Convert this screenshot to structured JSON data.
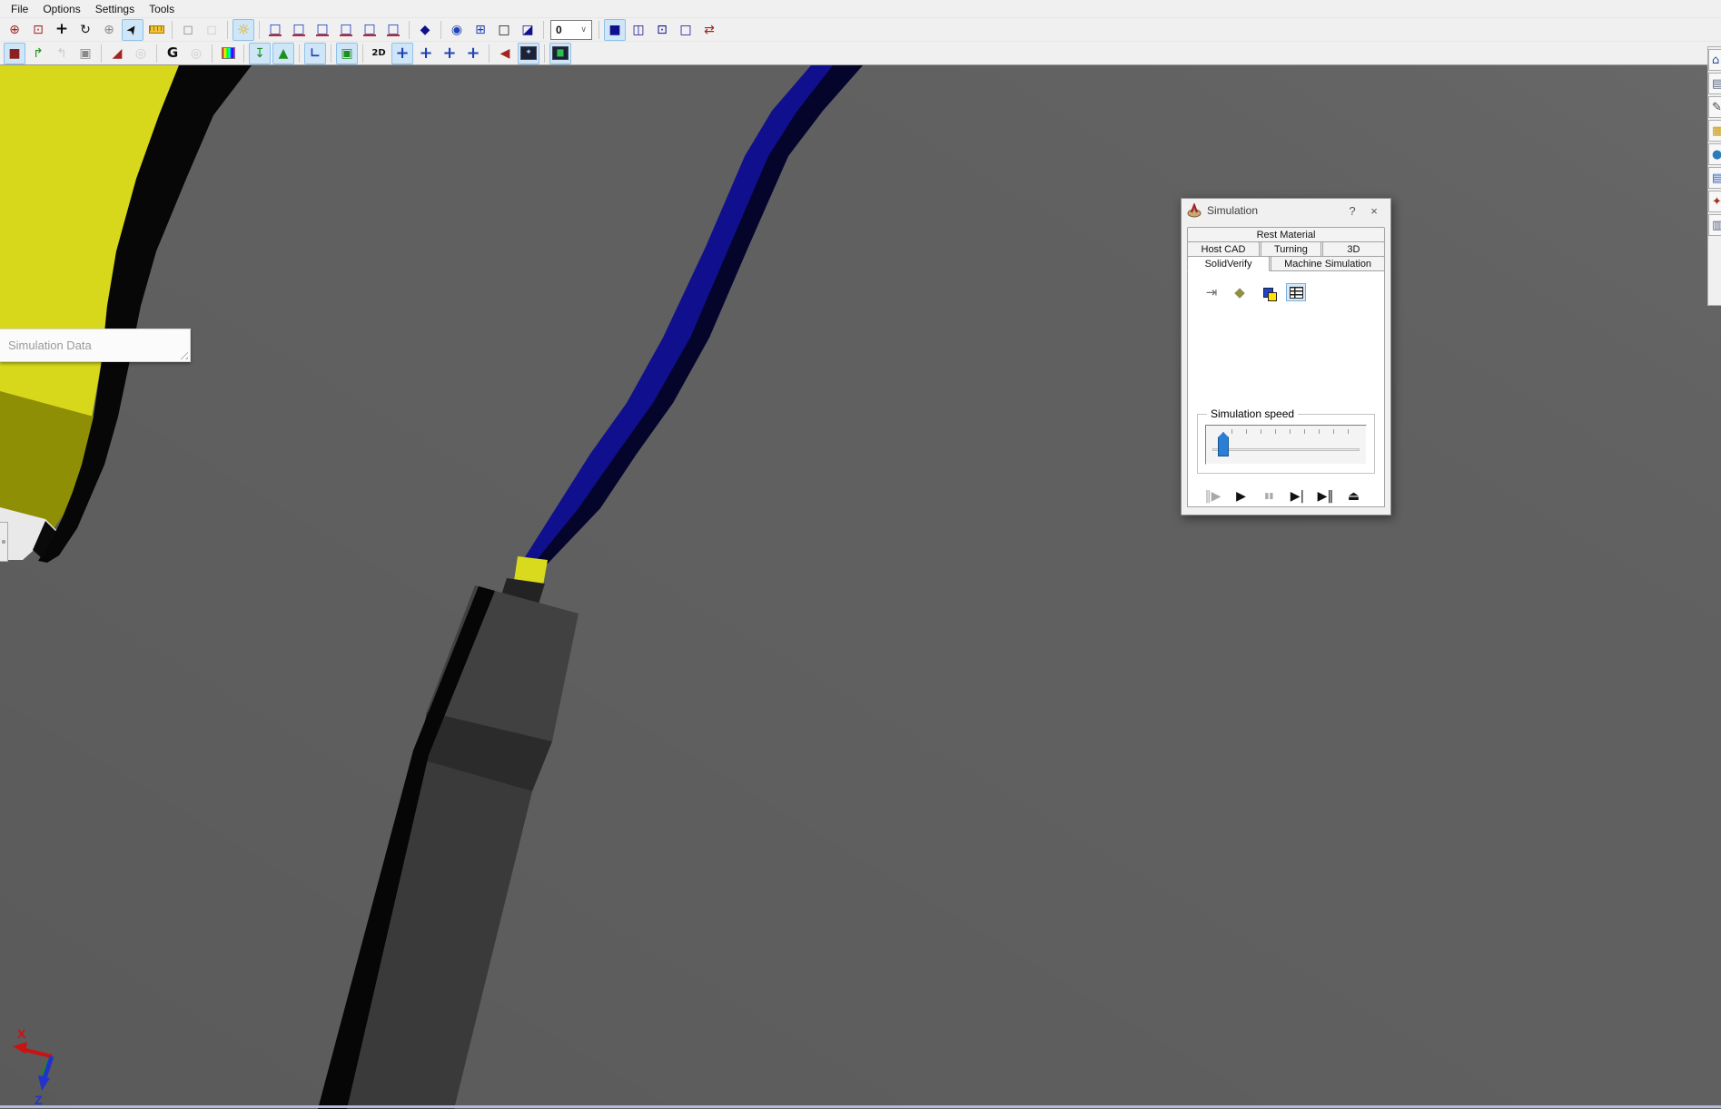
{
  "menu": {
    "items": [
      "File",
      "Options",
      "Settings",
      "Tools"
    ]
  },
  "toolbar1": {
    "buttons": [
      {
        "n": "zoom-plus-icon",
        "g": "⊕"
      },
      {
        "n": "zoom-window-icon",
        "g": "⊡"
      },
      {
        "n": "pan-icon",
        "g": "+"
      },
      {
        "n": "rotate-view-icon",
        "g": "↻"
      },
      {
        "n": "zoom-dynamic-icon",
        "g": "⊕"
      },
      {
        "n": "select-cursor-icon",
        "g": "➤"
      },
      {
        "n": "measure-icon",
        "g": ""
      },
      {
        "n": "face-select-icon",
        "g": "◻"
      },
      {
        "n": "face-select-alt-icon",
        "g": "◻"
      },
      {
        "n": "light-icon",
        "g": "☼"
      },
      {
        "n": "view-top-icon",
        "g": "□"
      },
      {
        "n": "view-front-icon",
        "g": "□"
      },
      {
        "n": "view-side-icon",
        "g": "□"
      },
      {
        "n": "view-iso1-icon",
        "g": "□"
      },
      {
        "n": "view-iso2-icon",
        "g": "□"
      },
      {
        "n": "view-iso3-icon",
        "g": "□"
      },
      {
        "n": "shaded-view-icon",
        "g": "◆"
      },
      {
        "n": "shell-icon",
        "g": "◉"
      },
      {
        "n": "combine-icon",
        "g": "⊞"
      },
      {
        "n": "box-icon",
        "g": "□"
      },
      {
        "n": "half-box-icon",
        "g": "◪"
      },
      {
        "n": "display-solid-icon",
        "g": "■"
      },
      {
        "n": "display-inner-icon",
        "g": "◫"
      },
      {
        "n": "display-wire-icon",
        "g": "⊡"
      },
      {
        "n": "display-outline-icon",
        "g": "□"
      },
      {
        "n": "refresh-arrows-icon",
        "g": "⇄"
      }
    ],
    "dropdown": {
      "value": "0",
      "chevron": "∨"
    }
  },
  "toolbar2": {
    "buttons": [
      {
        "n": "sim-solid-icon",
        "g": "■"
      },
      {
        "n": "op-forward-icon",
        "g": "↱"
      },
      {
        "n": "op-back-icon",
        "g": "↰"
      },
      {
        "n": "op-list-icon",
        "g": "▣"
      },
      {
        "n": "tool-red-icon",
        "g": "◢"
      },
      {
        "n": "tool-disabled-icon",
        "g": "◎"
      },
      {
        "n": "gcode-rotate-icon",
        "g": "G"
      },
      {
        "n": "gcode-disabled-icon",
        "g": "◎"
      },
      {
        "n": "color-scale-icon",
        "g": ""
      },
      {
        "n": "show-tool-icon",
        "g": "↧"
      },
      {
        "n": "show-holder-icon",
        "g": "▲"
      },
      {
        "n": "coord-sys-icon",
        "g": "∟"
      },
      {
        "n": "machine-housing-icon",
        "g": "▣"
      },
      {
        "n": "view-2d-icon",
        "g": "2D"
      },
      {
        "n": "section-1-icon",
        "g": "+"
      },
      {
        "n": "section-2-icon",
        "g": "+"
      },
      {
        "n": "section-3-icon",
        "g": "+"
      },
      {
        "n": "section-4-icon",
        "g": "+"
      },
      {
        "n": "rewind-red-icon",
        "g": "◀"
      },
      {
        "n": "night-view-icon",
        "g": "✦"
      },
      {
        "n": "chart-icon",
        "g": "▆"
      }
    ]
  },
  "right_toolbar": {
    "buttons": [
      {
        "n": "home-icon",
        "g": "⌂"
      },
      {
        "n": "template-icon",
        "g": "▤"
      },
      {
        "n": "edit-icon",
        "g": "✎"
      },
      {
        "n": "layers-icon",
        "g": "▦"
      },
      {
        "n": "globe-icon",
        "g": "●"
      },
      {
        "n": "table-icon",
        "g": "▤"
      },
      {
        "n": "tool-icon",
        "g": "✦"
      },
      {
        "n": "report-icon",
        "g": "▥"
      }
    ]
  },
  "viewport": {
    "panel_label": "Simulation Data"
  },
  "axes": {
    "x": "X",
    "z": "Z"
  },
  "dialog": {
    "title": "Simulation",
    "help": "?",
    "close": "×",
    "tabs_row1": [
      "Rest Material"
    ],
    "tabs_row2": [
      "Host CAD",
      "Turning",
      "3D"
    ],
    "tabs_row3": [
      "SolidVerify",
      "Machine Simulation"
    ],
    "active_tab": "SolidVerify",
    "icons": [
      {
        "n": "import-icon",
        "g": "⇥"
      },
      {
        "n": "fill-color-icon",
        "g": "◆"
      },
      {
        "n": "copy-layers-icon",
        "g": ""
      },
      {
        "n": "data-table-icon",
        "g": ""
      }
    ],
    "speed_group_label": "Simulation speed",
    "controls": [
      {
        "n": "step-button",
        "g": "‖▶",
        "enabled": false
      },
      {
        "n": "play-button",
        "g": "▶",
        "enabled": true
      },
      {
        "n": "pause-button",
        "g": "▮▮",
        "enabled": false
      },
      {
        "n": "next-button",
        "g": "▶|",
        "enabled": true
      },
      {
        "n": "play-to-button",
        "g": "▶‖",
        "enabled": true
      },
      {
        "n": "eject-button",
        "g": "⏏",
        "enabled": true
      }
    ]
  },
  "colors": {
    "viewport_bg": "#606060",
    "stock_yellow": "#d7d81b",
    "stock_olive": "#8e8f04",
    "shadow_black": "#070707",
    "path_blue": "#10108e",
    "path_blue_dark": "#05052c",
    "insert_yellow": "#d9da1e",
    "tool_gray": "#414141",
    "tool_chamfer": "#2b2b2b",
    "tool_lower": "#3a3a3a",
    "face_light": "#e9e9e9",
    "axis_x": "#cc1111",
    "axis_y": "#0a9a0a",
    "axis_z": "#2233cc"
  }
}
